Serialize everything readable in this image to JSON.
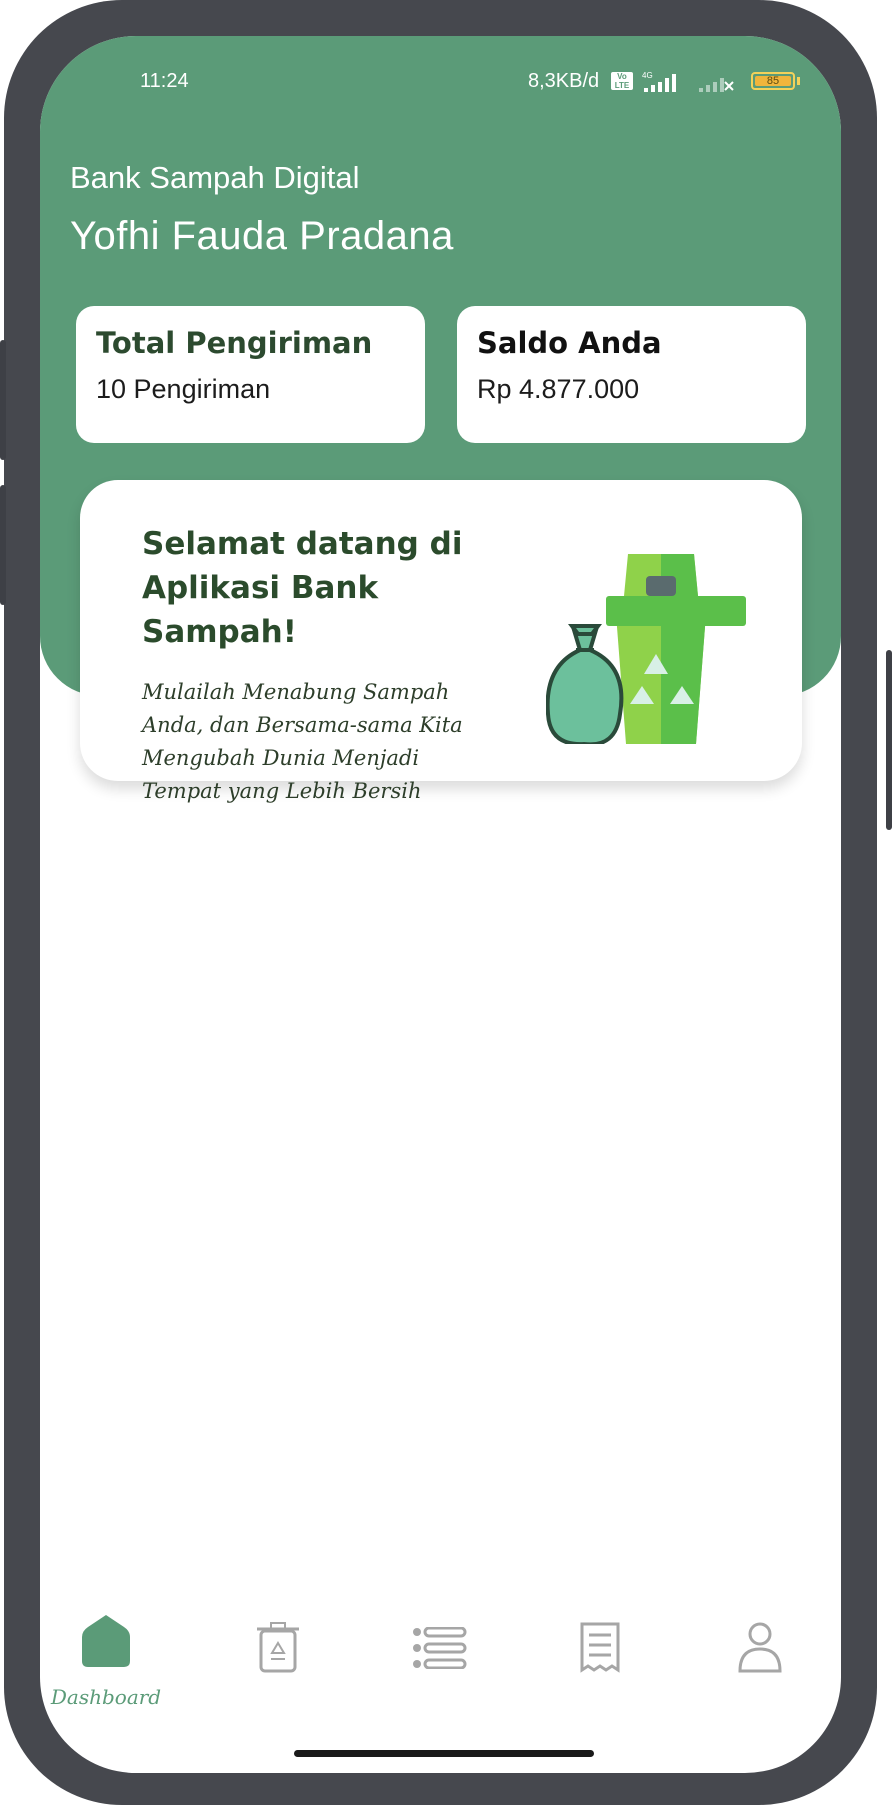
{
  "status_bar": {
    "time": "11:24",
    "network_speed": "8,3KB/d",
    "volte_label": "Vo LTE",
    "network_type": "4G",
    "battery_level": "85"
  },
  "header": {
    "app_subtitle": "Bank Sampah Digital",
    "user_name": "Yofhi Fauda Pradana"
  },
  "stats": {
    "deliveries": {
      "title": "Total Pengiriman",
      "value": "10 Pengiriman"
    },
    "balance": {
      "title": "Saldo Anda",
      "value": "Rp 4.877.000"
    }
  },
  "welcome": {
    "title": "Selamat datang di Aplikasi Bank Sampah!",
    "message": "Mulailah Menabung Sampah Anda, dan Bersama-sama Kita Mengubah Dunia Menjadi Tempat yang Lebih Bersih"
  },
  "bottom_nav": {
    "active_index": 0,
    "items": [
      {
        "icon": "home-icon",
        "label": "Dashboard"
      },
      {
        "icon": "recycle-bin-icon",
        "label": ""
      },
      {
        "icon": "list-icon",
        "label": ""
      },
      {
        "icon": "receipt-icon",
        "label": ""
      },
      {
        "icon": "profile-icon",
        "label": ""
      }
    ]
  },
  "colors": {
    "primary": "#5b9b78",
    "dark_green": "#2b4b2c",
    "frame": "#46484e",
    "battery": "#f0b53c"
  }
}
